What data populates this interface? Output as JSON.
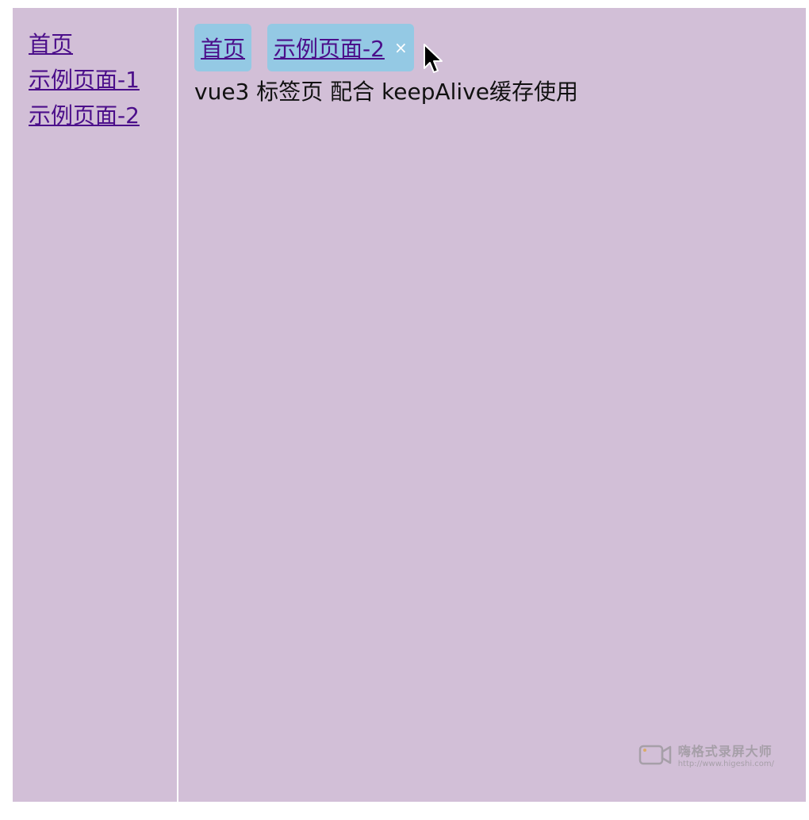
{
  "sidebar": {
    "links": [
      {
        "label": "首页"
      },
      {
        "label": "示例页面-1"
      },
      {
        "label": "示例页面-2"
      }
    ]
  },
  "tabs": [
    {
      "label": "首页"
    },
    {
      "label": "示例页面-2",
      "close": "×"
    }
  ],
  "main": {
    "text": "vue3 标签页 配合 keepAlive缓存使用"
  },
  "watermark": {
    "title": "嗨格式录屏大师",
    "url": "http://www.higeshi.com/"
  },
  "colors": {
    "background": "#d2bfd7",
    "tab_background": "#94c9e4",
    "link": "#4b0e8a"
  }
}
